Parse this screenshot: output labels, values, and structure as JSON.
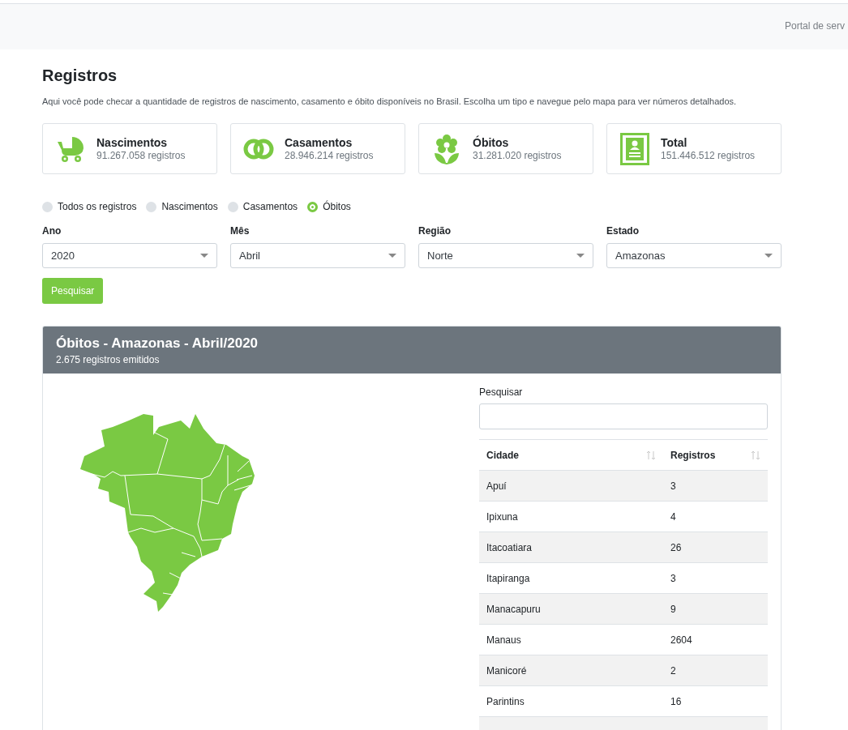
{
  "header": {
    "link": "Portal de serv"
  },
  "page": {
    "title": "Registros",
    "description": "Aqui você pode checar a quantidade de registros de nascimento, casamento e óbito disponíveis no Brasil. Escolha um tipo e navegue pelo mapa para ver números detalhados."
  },
  "stats": [
    {
      "kind": "birth",
      "title": "Nascimentos",
      "value": "91.267.058 registros"
    },
    {
      "kind": "marriage",
      "title": "Casamentos",
      "value": "28.946.214 registros"
    },
    {
      "kind": "death",
      "title": "Óbitos",
      "value": "31.281.020 registros"
    },
    {
      "kind": "total",
      "title": "Total",
      "value": "151.446.512 registros"
    }
  ],
  "record_types": [
    {
      "label": "Todos os registros",
      "selected": false
    },
    {
      "label": "Nascimentos",
      "selected": false
    },
    {
      "label": "Casamentos",
      "selected": false
    },
    {
      "label": "Óbitos",
      "selected": true
    }
  ],
  "filters": [
    {
      "label": "Ano",
      "value": "2020"
    },
    {
      "label": "Mês",
      "value": "Abril"
    },
    {
      "label": "Região",
      "value": "Norte"
    },
    {
      "label": "Estado",
      "value": "Amazonas"
    }
  ],
  "search_button": "Pesquisar",
  "result": {
    "title": "Óbitos - Amazonas - Abril/2020",
    "subtitle": "2.675 registros emitidos",
    "search_label": "Pesquisar",
    "table": {
      "columns": [
        "Cidade",
        "Registros"
      ],
      "rows": [
        [
          "Apuí",
          "3"
        ],
        [
          "Ipixuna",
          "4"
        ],
        [
          "Itacoatiara",
          "26"
        ],
        [
          "Itapiranga",
          "3"
        ],
        [
          "Manacapuru",
          "9"
        ],
        [
          "Manaus",
          "2604"
        ],
        [
          "Manicoré",
          "2"
        ],
        [
          "Parintins",
          "16"
        ]
      ]
    }
  }
}
